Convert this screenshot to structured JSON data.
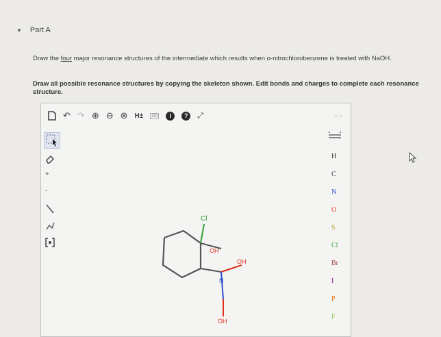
{
  "part": {
    "toggle_icon": "triangle-down-icon",
    "title": "Part A"
  },
  "instructions": {
    "line1_pre": "Draw the ",
    "line1_underlined": "four",
    "line1_post": " major resonance structures of the intermediate which results when o-nitrochlorobenzene is treated with NaOH.",
    "line2": "Draw all possible resonance structures by copying the skeleton shown. Edit bonds and charges to complete each resonance structure."
  },
  "toolbar": {
    "icons": [
      "new-document-icon",
      "undo-icon",
      "redo-icon",
      "zoom-in-icon",
      "zoom-out-icon",
      "zoom-reset-icon",
      "explicit-hydrogens-icon",
      "2d-clean-icon",
      "info-icon",
      "help-icon",
      "fullscreen-icon"
    ],
    "explicit_h_label": "H±",
    "clean_label": "2D",
    "expand_label": "< >"
  },
  "left_tools": [
    "select-tool",
    "eraser-tool",
    "positive-charge-tool",
    "negative-charge-tool",
    "single-bond-tool",
    "chain-tool",
    "bracket-tool"
  ],
  "left_labels": {
    "plus": "+",
    "minus": "-"
  },
  "elements": [
    "H",
    "C",
    "N",
    "O",
    "S",
    "Cl",
    "Br",
    "I",
    "P",
    "F"
  ],
  "periodic_table_icon": "periodic-table-icon",
  "element_colors": {
    "H": "#333333",
    "C": "#333333",
    "N": "#3050c8",
    "O": "#e03020",
    "S": "#b8a020",
    "Cl": "#30a030",
    "Br": "#a04040",
    "I": "#902090",
    "P": "#e07000",
    "F": "#80c040"
  },
  "molecule": {
    "labels": {
      "cl": "Cl",
      "oh_top": "OH",
      "n_plus": "N",
      "oh_mid": "OH",
      "oh_bottom": "OH"
    },
    "colors": {
      "ring": "#555555",
      "n": "#3050c8",
      "o": "#e03020",
      "cl": "#30a030"
    }
  }
}
